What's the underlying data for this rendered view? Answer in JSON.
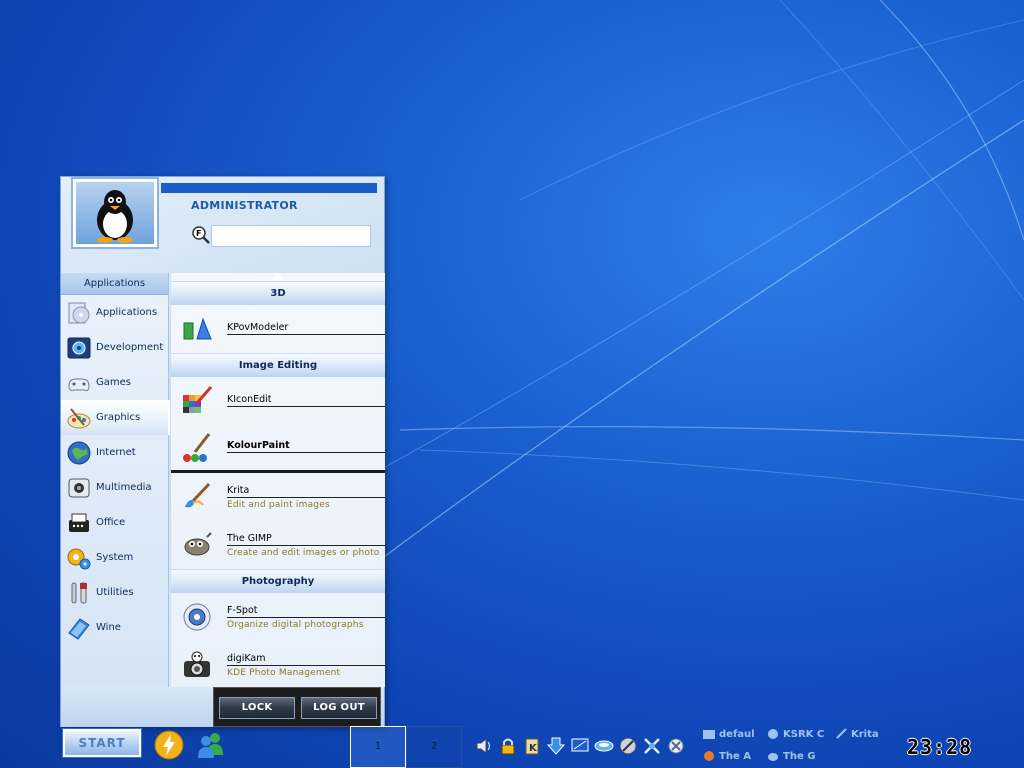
{
  "user": {
    "name": "ADMINISTRATOR"
  },
  "search": {
    "placeholder": "",
    "value": ""
  },
  "categories": {
    "header": "Applications",
    "items": [
      {
        "label": "Applications",
        "icon": "applications-icon"
      },
      {
        "label": "Development",
        "icon": "development-icon"
      },
      {
        "label": "Games",
        "icon": "games-icon"
      },
      {
        "label": "Graphics",
        "icon": "graphics-icon",
        "selected": true
      },
      {
        "label": "Internet",
        "icon": "internet-icon"
      },
      {
        "label": "Multimedia",
        "icon": "multimedia-icon"
      },
      {
        "label": "Office",
        "icon": "office-icon"
      },
      {
        "label": "System",
        "icon": "system-icon"
      },
      {
        "label": "Utilities",
        "icon": "utilities-icon"
      },
      {
        "label": "Wine",
        "icon": "wine-icon"
      }
    ]
  },
  "apps": {
    "sections": [
      {
        "title": "3D",
        "items": [
          {
            "name": "KPovModeler",
            "desc": "",
            "icon": "kpovmodeler-icon"
          }
        ]
      },
      {
        "title": "Image Editing",
        "items": [
          {
            "name": "KIconEdit",
            "desc": "",
            "icon": "kiconedit-icon"
          },
          {
            "name": "KolourPaint",
            "desc": "",
            "icon": "kolourpaint-icon"
          },
          {
            "name": "Krita",
            "desc": "Edit and paint images",
            "icon": "krita-icon"
          },
          {
            "name": "The GIMP",
            "desc": "Create and edit images or photo",
            "icon": "gimp-icon"
          }
        ]
      },
      {
        "title": "Photography",
        "items": [
          {
            "name": "F-Spot",
            "desc": "Organize digital photographs",
            "icon": "fspot-icon"
          },
          {
            "name": "digiKam",
            "desc": "KDE Photo Management",
            "icon": "digikam-icon"
          }
        ]
      }
    ]
  },
  "footer": {
    "lock_label": "LOCK",
    "logout_label": "LOG OUT"
  },
  "taskbar": {
    "start_label": "START",
    "pager": [
      "1",
      "2"
    ],
    "tasks": [
      {
        "label": "defaul",
        "icon": "folder-icon"
      },
      {
        "label": "KSRK C",
        "icon": "ksnapshot-icon"
      },
      {
        "label": "Krita",
        "icon": "krita-icon"
      },
      {
        "label": "The A",
        "icon": "firefox-icon"
      },
      {
        "label": "The G",
        "icon": "gimp-icon"
      }
    ],
    "clock": "23:28"
  },
  "colors": {
    "taskbar_blue": "#1a5fd0",
    "menu_accent": "#1a5cc8"
  }
}
